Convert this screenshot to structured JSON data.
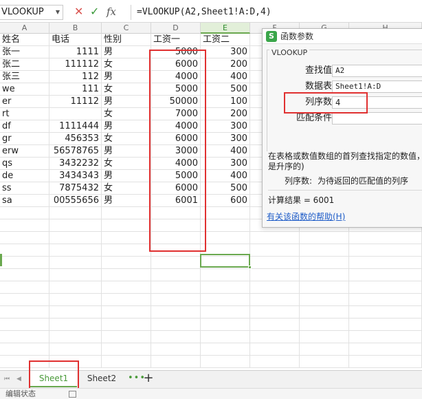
{
  "formula_bar": {
    "name_box": "VLOOKUP",
    "cancel_icon": "✕",
    "enter_icon": "✓",
    "fx_icon": "fx",
    "formula": "=VLOOKUP(A2,Sheet1!A:D,4)"
  },
  "columns": [
    "A",
    "B",
    "C",
    "D",
    "E",
    "F",
    "G",
    "H"
  ],
  "header_row": [
    "姓名",
    "电话",
    "性别",
    "工资一",
    "工资二",
    "",
    "",
    ""
  ],
  "rows": [
    [
      "张一",
      "1111",
      "男",
      "5000",
      "300"
    ],
    [
      "张二",
      "111112",
      "女",
      "6000",
      "200"
    ],
    [
      "张三",
      "112",
      "男",
      "4000",
      "400"
    ],
    [
      "we",
      "111",
      "女",
      "5000",
      "500"
    ],
    [
      "er",
      "11112",
      "男",
      "50000",
      "100"
    ],
    [
      "rt",
      "",
      "女",
      "7000",
      "200"
    ],
    [
      "df",
      "1111444",
      "男",
      "4000",
      "300"
    ],
    [
      "gr",
      "456353",
      "女",
      "6000",
      "300"
    ],
    [
      "erw",
      "56578765",
      "男",
      "3000",
      "400"
    ],
    [
      "qs",
      "3432232",
      "女",
      "4000",
      "300"
    ],
    [
      "de",
      "3434343",
      "男",
      "5000",
      "400"
    ],
    [
      "ss",
      "7875432",
      "女",
      "6000",
      "500"
    ],
    [
      "sa",
      "00555656",
      "男",
      "6001",
      "600"
    ]
  ],
  "dialog": {
    "logo": "S",
    "title": "函数参数",
    "function_name": "VLOOKUP",
    "params": [
      {
        "label": "查找值",
        "value": "A2"
      },
      {
        "label": "数据表",
        "value": "Sheet1!A:D"
      },
      {
        "label": "列序数",
        "value": "4"
      },
      {
        "label": "匹配条件",
        "value": ""
      }
    ],
    "description": "在表格或数值数组的首列查找指定的数值，表是升序的)",
    "param_desc_label": "列序数:",
    "param_desc_text": "为待返回的匹配值的列序",
    "result": "计算结果 = 6001",
    "help_link": "有关该函数的帮助(H)"
  },
  "tabs": {
    "first_icon": "⏮",
    "prev_icon": "◀",
    "sheets": [
      "Sheet1",
      "Sheet2"
    ],
    "more_icon": "•••",
    "add_icon": "+"
  },
  "status": {
    "text": "编辑状态"
  },
  "colors": {
    "accent": "#6aa84f",
    "highlight": "#e03030",
    "link": "#1e5cc8"
  }
}
